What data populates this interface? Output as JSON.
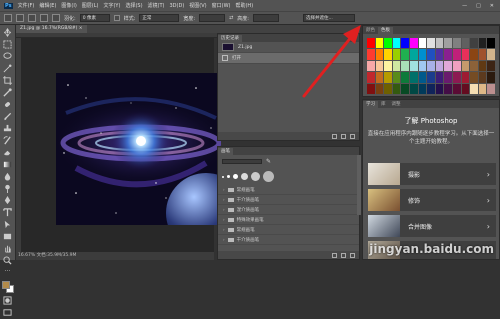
{
  "menubar": {
    "items": [
      "文件(F)",
      "编辑(E)",
      "图像(I)",
      "图层(L)",
      "文字(Y)",
      "选择(S)",
      "滤镜(T)",
      "3D(D)",
      "视图(V)",
      "窗口(W)",
      "帮助(H)"
    ],
    "window_controls": [
      "—",
      "□",
      "✕"
    ]
  },
  "options": {
    "feather_label": "羽化:",
    "feather_value": "0 像素",
    "style_label": "样式:",
    "style_value": "正常",
    "width_label": "宽度:",
    "height_label": "高度:",
    "select_mask": "选择并遮住..."
  },
  "document": {
    "tab": "Z1.jpg @ 16.7%(RGB/8#) ×",
    "status": "16.67%   文档:35.9M/35.9M"
  },
  "history": {
    "tabs": [
      "历史记录"
    ],
    "rows": [
      {
        "label": "Z1.jpg"
      },
      {
        "label": "打开"
      }
    ]
  },
  "brushes": {
    "tabs": [
      "画笔"
    ],
    "sizes": [
      "1",
      "3",
      "5",
      "9",
      "13",
      "19"
    ],
    "groups": [
      "常规画笔",
      "干介质画笔",
      "湿介质画笔",
      "特殊效果画笔",
      "常规画笔",
      "干介质画笔"
    ]
  },
  "swatches": {
    "tabs": [
      "颜色",
      "色板"
    ],
    "colors": [
      "#ff0000",
      "#ffff00",
      "#00ff00",
      "#00ffff",
      "#0000ff",
      "#ff00ff",
      "#ffffff",
      "#e0e0e0",
      "#c0c0c0",
      "#a0a0a0",
      "#808080",
      "#606060",
      "#404040",
      "#202020",
      "#000000",
      "#ff3b30",
      "#ff7f00",
      "#ffd400",
      "#9ad000",
      "#20b050",
      "#00a79d",
      "#0090d0",
      "#2050c0",
      "#5030a0",
      "#8a2090",
      "#c0207a",
      "#e8305a",
      "#8b4513",
      "#a0522d",
      "#d2b48c",
      "#f7a8a8",
      "#f9c79a",
      "#fff3a0",
      "#cfe8a0",
      "#a8e0b8",
      "#a0e0e0",
      "#a0c8f0",
      "#a8b0e8",
      "#c0a8e0",
      "#e0a8d8",
      "#f0a0c0",
      "#c49a6c",
      "#8c6239",
      "#603913",
      "#3c2415",
      "#c1272d",
      "#c36a1e",
      "#b59b00",
      "#5a8c1a",
      "#0e7a3a",
      "#00706a",
      "#005a8c",
      "#1b3c8c",
      "#3c1e78",
      "#6a1b6e",
      "#8c1a52",
      "#9e1b32",
      "#754c24",
      "#5c3a1e",
      "#2b1a0e",
      "#801010",
      "#7a4010",
      "#6e6000",
      "#345a10",
      "#084a24",
      "#004844",
      "#003a5a",
      "#10245a",
      "#24104e",
      "#440e46",
      "#5a0c34",
      "#640c20",
      "#f5deb3",
      "#deb887",
      "#bc8f8f"
    ]
  },
  "learn": {
    "tabs": [
      "学习",
      "库",
      "调整"
    ],
    "title": "了解 Photoshop",
    "description": "直接在应用程序内跟随逐步教程学习。从下面选择一个主题开始教程。",
    "topics": [
      "摄影",
      "修饰",
      "合并图像"
    ]
  },
  "watermark": "jingyan.baidu.com",
  "colors": {
    "arrow": "#e02020",
    "panel": "#535353",
    "dark": "#323232"
  }
}
